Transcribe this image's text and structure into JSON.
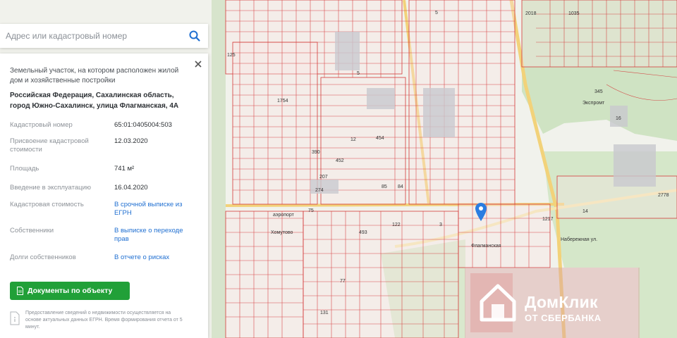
{
  "search": {
    "placeholder": "Адрес или кадастровый номер"
  },
  "icons": {
    "search": "search-icon",
    "close": "close-icon",
    "document": "document-icon",
    "info": "info-icon",
    "pin": "location-pin-icon",
    "house": "house-icon"
  },
  "colors": {
    "accent": "#21a038",
    "link": "#1f6fd1",
    "parcel_line": "#d43a3a",
    "pin": "#2a7de1"
  },
  "panel": {
    "description": "Земельный участок, на котором расположен жилой дом и хозяйственные постройки",
    "address": "Российская Федерация, Сахалинская область, город Южно-Сахалинск, улица Флагманская, 4А",
    "rows": [
      {
        "label": "Кадастровый номер",
        "value": "65:01:0405004:503",
        "link": false
      },
      {
        "label": "Присвоение кадастровой стоимости",
        "value": "12.03.2020",
        "link": false
      },
      {
        "label": "Площадь",
        "value": "741 м²",
        "link": false
      },
      {
        "label": "Введение в эксплуатацию",
        "value": "16.04.2020",
        "link": false
      },
      {
        "label": "Кадастровая стоимость",
        "value": "В срочной выписке из ЕГРН",
        "link": true
      },
      {
        "label": "Собственники",
        "value": "В выписке о переходе прав",
        "link": true
      },
      {
        "label": "Долги собственников",
        "value": "В отчете о рисках",
        "link": true
      }
    ],
    "docs_button": "Документы по объекту",
    "notice": "Предоставление сведений о недвижимости осуществляется на основе актуальных данных ЕГРН. Время формирования отчета от 5 минут."
  },
  "map": {
    "labels": [
      "125",
      "1754",
      "5",
      "454",
      "12",
      "390",
      "452",
      "207",
      "274",
      "75",
      "493",
      "122",
      "3",
      "85",
      "84",
      "77",
      "131",
      "2778",
      "14",
      "16",
      "5",
      "1217",
      "1035",
      "2018",
      "345",
      "аэропорт",
      "Хомутово",
      "Флагманская",
      "Набережная ул.",
      "Экспромт"
    ]
  },
  "watermark": {
    "brand": "ДомКлик",
    "sub": "ОТ СБЕРБАНКА"
  }
}
